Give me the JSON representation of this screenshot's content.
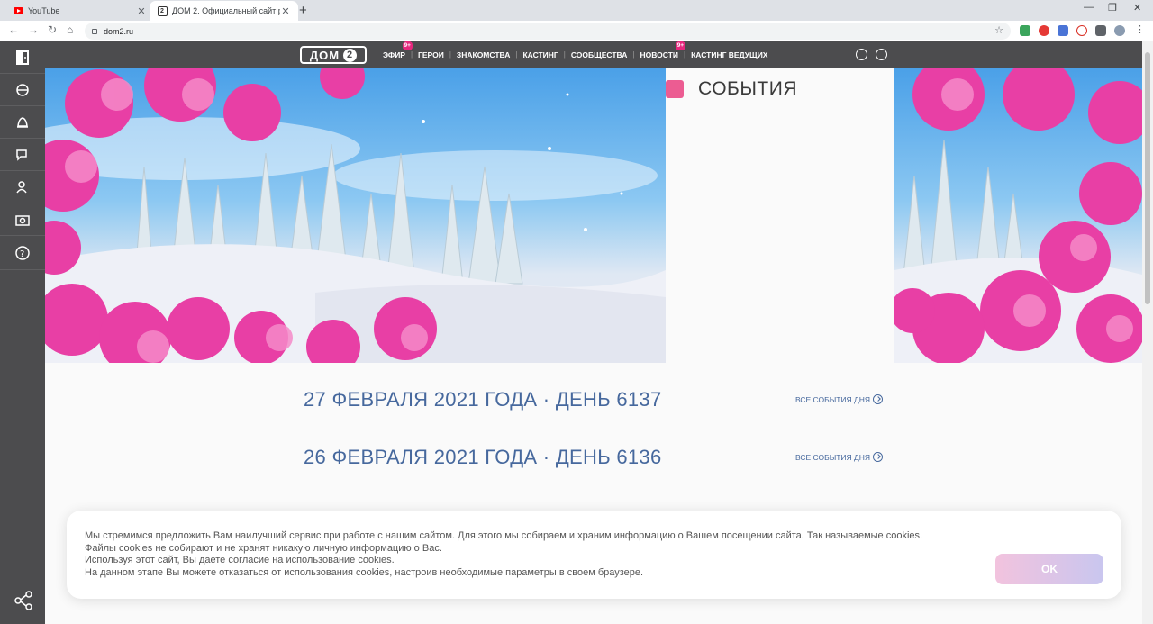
{
  "browser": {
    "tabs": [
      {
        "title": "YouTube"
      },
      {
        "title": "ДОМ 2. Официальный сайт ре…"
      }
    ],
    "url": "dom2.ru"
  },
  "site": {
    "logo_text": "ДОМ",
    "logo_num": "2",
    "menu": [
      {
        "label": "ЭФИР",
        "badge": "9+"
      },
      {
        "label": "ГЕРОИ",
        "badge": ""
      },
      {
        "label": "ЗНАКОМСТВА",
        "badge": ""
      },
      {
        "label": "КАСТИНГ",
        "badge": ""
      },
      {
        "label": "СООБЩЕСТВА",
        "badge": ""
      },
      {
        "label": "НОВОСТИ",
        "badge": "9+"
      },
      {
        "label": "КАСТИНГ ВЕДУЩИХ",
        "badge": ""
      }
    ],
    "events_title": "СОБЫТИЯ",
    "days": [
      {
        "title": "27 ФЕВРАЛЯ 2021 ГОДА · ДЕНЬ 6137",
        "link": "ВСЕ СОБЫТИЯ ДНЯ"
      },
      {
        "title": "26 ФЕВРАЛЯ 2021 ГОДА · ДЕНЬ 6136",
        "link": "ВСЕ СОБЫТИЯ ДНЯ"
      }
    ]
  },
  "cookie": {
    "line1": "Мы стремимся предложить Вам наилучший сервис при работе с нашим сайтом. Для этого мы собираем и храним информацию о Вашем посещении сайта. Так называемые cookies. Файлы cookies не собирают и не хранят никакую личную информацию о Вас.",
    "line2": "Используя этот сайт, Вы даете согласие на использование cookies.",
    "line3": "На данном этапе Вы можете отказаться от использования cookies, настроив необходимые параметры в своем браузере.",
    "ok": "OK"
  },
  "colors": {
    "header_bg": "#4c4c4e",
    "accent_pink": "#e6287d",
    "title_blue": "#46689d"
  }
}
